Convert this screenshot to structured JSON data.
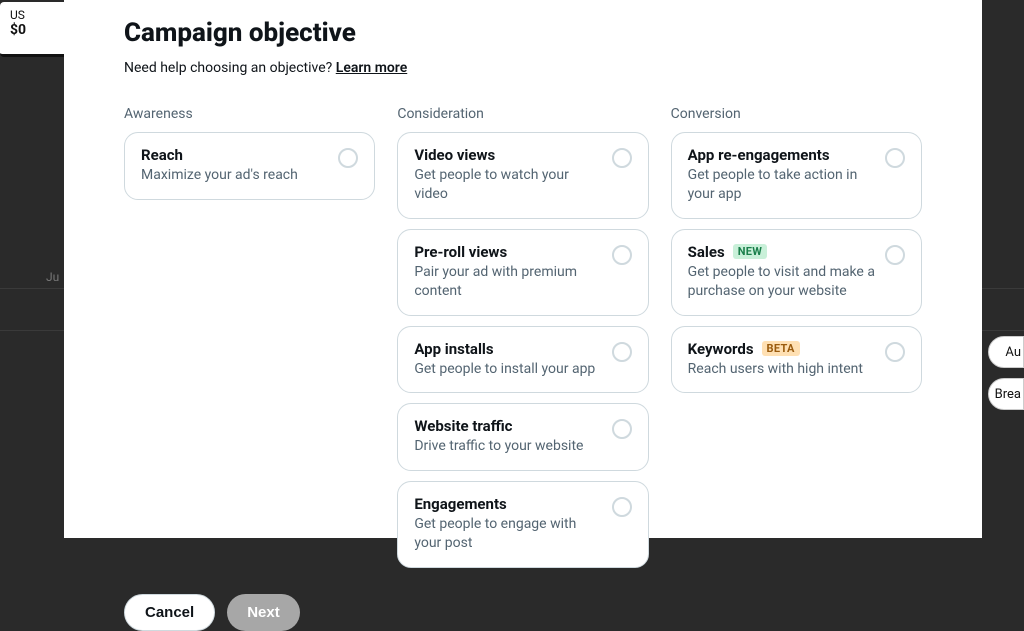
{
  "pageTitle": "Campaign objective",
  "helpText": "Need help choosing an objective? ",
  "learnMore": "Learn more",
  "bg": {
    "usLabel": "US",
    "amount": "$0",
    "ju": "Ju",
    "au": "Au",
    "brea": "Brea"
  },
  "columns": {
    "awareness": {
      "header": "Awareness",
      "cards": [
        {
          "title": "Reach",
          "desc": "Maximize your ad's reach"
        }
      ]
    },
    "consideration": {
      "header": "Consideration",
      "cards": [
        {
          "title": "Video views",
          "desc": "Get people to watch your video"
        },
        {
          "title": "Pre-roll views",
          "desc": "Pair your ad with premium content"
        },
        {
          "title": "App installs",
          "desc": "Get people to install your app"
        },
        {
          "title": "Website traffic",
          "desc": "Drive traffic to your website"
        },
        {
          "title": "Engagements",
          "desc": "Get people to engage with your post"
        }
      ]
    },
    "conversion": {
      "header": "Conversion",
      "cards": [
        {
          "title": "App re-engagements",
          "desc": "Get people to take action in your app"
        },
        {
          "title": "Sales",
          "badge": "NEW",
          "desc": "Get people to visit and make a purchase on your website"
        },
        {
          "title": "Keywords",
          "badge": "BETA",
          "desc": "Reach users with high intent"
        }
      ]
    }
  },
  "footer": {
    "cancel": "Cancel",
    "next": "Next"
  }
}
